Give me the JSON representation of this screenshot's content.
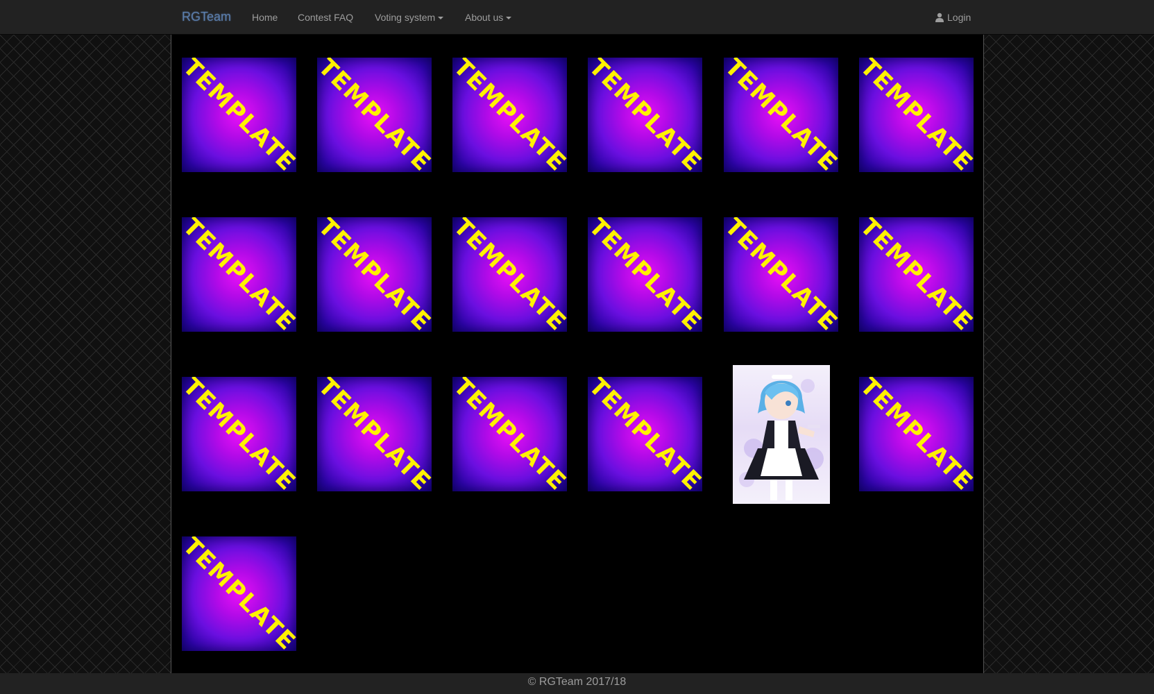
{
  "navbar": {
    "brand": "RGTeam",
    "links": [
      {
        "label": "Home"
      },
      {
        "label": "Contest FAQ"
      },
      {
        "label": "Voting system",
        "dropdown": true
      },
      {
        "label": "About us",
        "dropdown": true
      }
    ],
    "login_label": "Login",
    "login_icon": "user-icon"
  },
  "gallery": {
    "card_text": "TEMPLATE",
    "tiles": [
      {
        "type": "template",
        "text": "TEMPLATE"
      },
      {
        "type": "template",
        "text": "TEMPLATE"
      },
      {
        "type": "template",
        "text": "TEMPLATE"
      },
      {
        "type": "template",
        "text": "TEMPLATE"
      },
      {
        "type": "template",
        "text": "TEMPLATE"
      },
      {
        "type": "template",
        "text": "TEMPLATE"
      },
      {
        "type": "template",
        "text": "TEMPLATE"
      },
      {
        "type": "template",
        "text": "TEMPLATE"
      },
      {
        "type": "template",
        "text": "TEMPLATE"
      },
      {
        "type": "template",
        "text": "TEMPLATE"
      },
      {
        "type": "template",
        "text": "TEMPLATE"
      },
      {
        "type": "template",
        "text": "TEMPLATE"
      },
      {
        "type": "template",
        "text": "TEMPLATE"
      },
      {
        "type": "template",
        "text": "TEMPLATE"
      },
      {
        "type": "template",
        "text": "TEMPLATE"
      },
      {
        "type": "template",
        "text": "TEMPLATE"
      },
      {
        "type": "image",
        "subject": "anime-maid-girl-illustration"
      },
      {
        "type": "template",
        "text": "TEMPLATE"
      },
      {
        "type": "template",
        "text": "TEMPLATE"
      }
    ]
  },
  "footer": {
    "text": "© RGTeam 2017/18"
  },
  "colors": {
    "navbar_bg": "#222222",
    "nav_text": "#9d9d9d",
    "brand": "#5b7fae",
    "card_magenta": "#ea10f5",
    "card_blue": "#2c04a8",
    "card_text": "#fff200",
    "page_bg": "#000000"
  }
}
